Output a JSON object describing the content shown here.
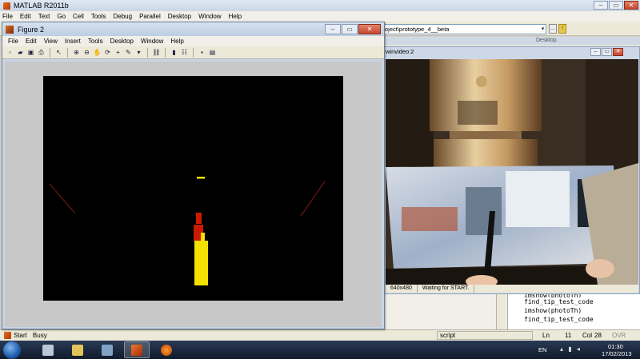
{
  "app": {
    "title": "MATLAB  R2011b",
    "menu": [
      "File",
      "Edit",
      "Text",
      "Go",
      "Cell",
      "Tools",
      "Debug",
      "Parallel",
      "Desktop",
      "Window",
      "Help"
    ],
    "current_folder": "oject\\prototype_4__beta",
    "browse_label": "...",
    "background_window_title": "Desktop"
  },
  "figure": {
    "title": "Figure 2",
    "menu": [
      "File",
      "Edit",
      "View",
      "Insert",
      "Tools",
      "Desktop",
      "Window",
      "Help"
    ]
  },
  "video": {
    "title": "winvideo:2",
    "resolution": "640x480",
    "status": "Waiting for START."
  },
  "command_history": [
    "imshow(photoTh)",
    "find_tip_test_code",
    "imshow(photoTh)",
    "find_tip_test_code"
  ],
  "statusbar": {
    "start": "Start",
    "busy": "Busy",
    "mode": "script",
    "ln_label": "Ln",
    "ln": "11",
    "col_label": "Col",
    "col": "28",
    "ovr": "OVR"
  },
  "taskbar": {
    "lang": "EN",
    "time": "01:30",
    "date": "17/02/2013"
  },
  "colors": {
    "blob_yellow": "#f5e000",
    "blob_red": "#cc1a00",
    "accent_orange": "#e06d1a"
  }
}
